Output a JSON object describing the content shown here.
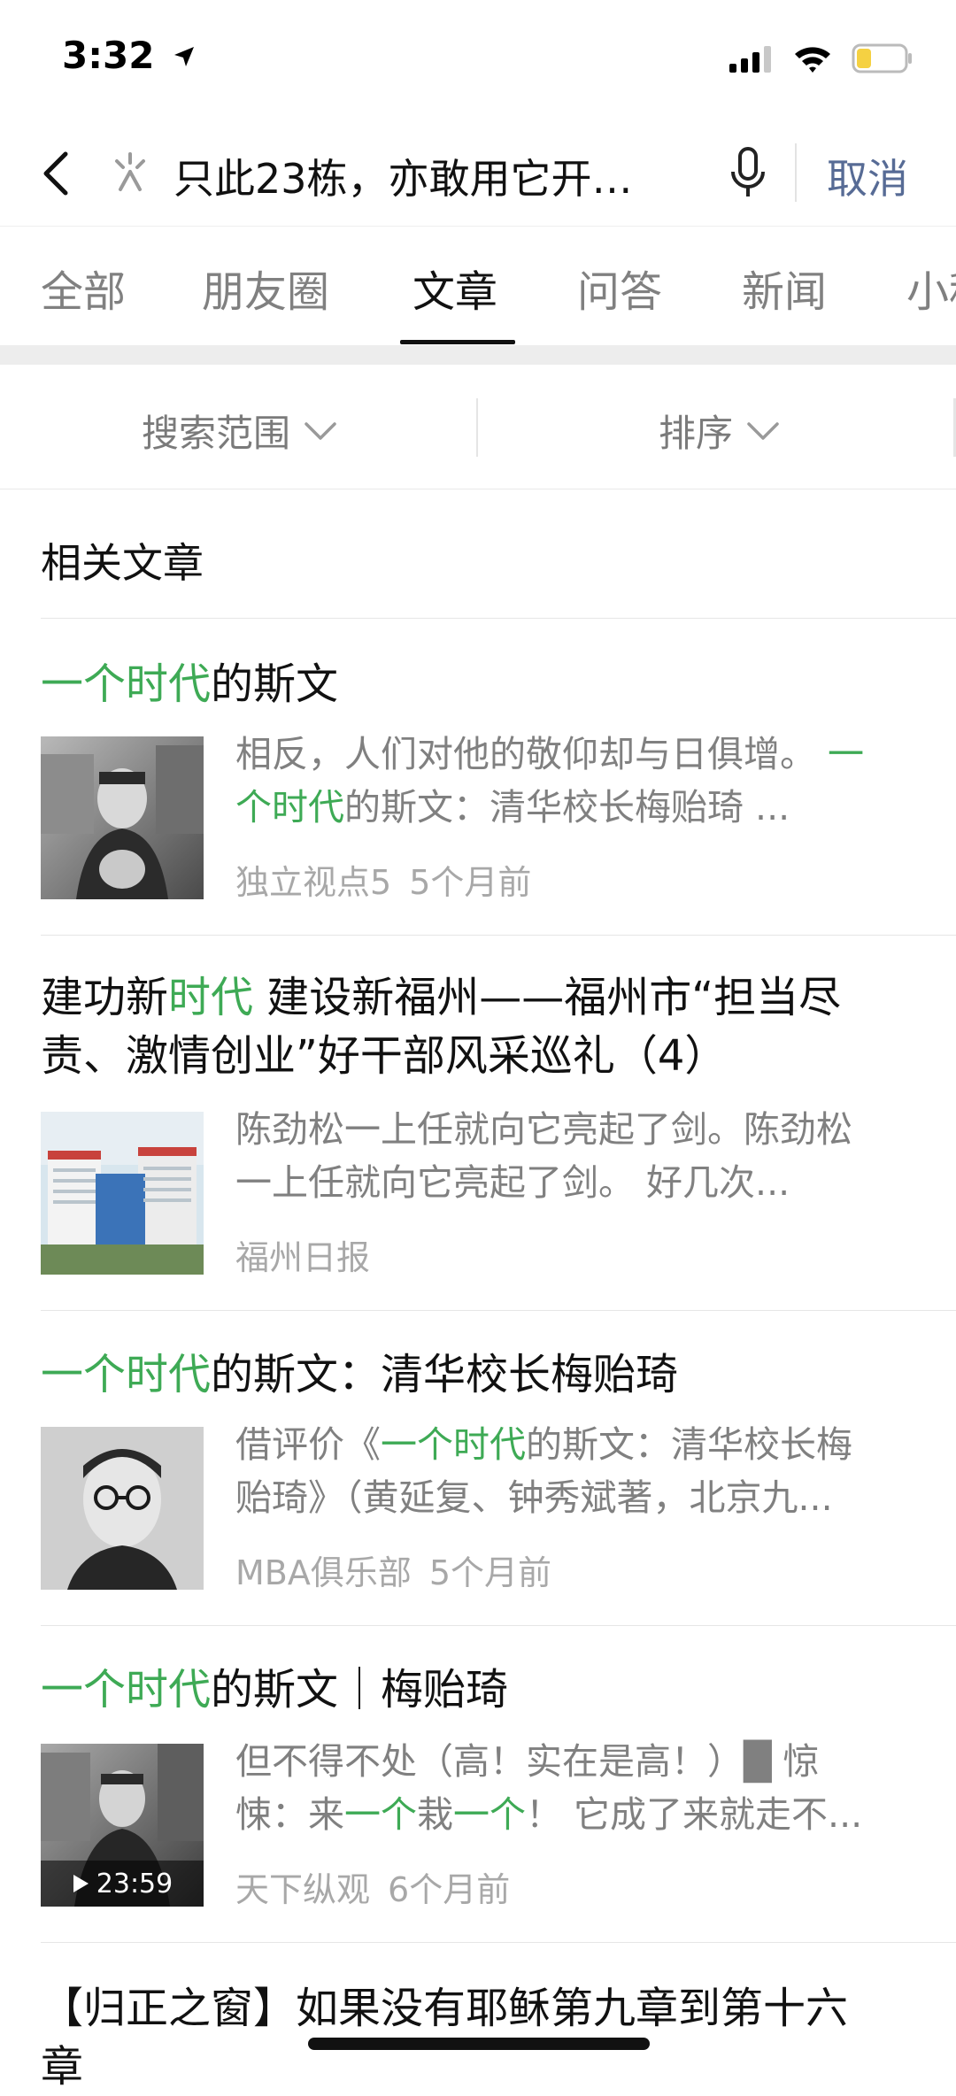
{
  "status_bar": {
    "time": "3:32"
  },
  "search": {
    "query": "只此23栋，亦敢用它开…",
    "cancel_label": "取消"
  },
  "tabs": [
    {
      "label": "全部"
    },
    {
      "label": "朋友圈"
    },
    {
      "label": "文章",
      "active": true
    },
    {
      "label": "问答"
    },
    {
      "label": "新闻"
    },
    {
      "label": "小程"
    }
  ],
  "filters": {
    "scope_label": "搜索范围",
    "sort_label": "排序"
  },
  "section_title": "相关文章",
  "articles": [
    {
      "title_hl": "一个时代",
      "title_rest": "的斯文",
      "snippet_line1_pre": "相反，人们对他的敬仰却与日俱增。",
      "snippet_line1_hl": "一",
      "snippet_line2_hl": "个时代",
      "snippet_line2_rest": "的斯文：清华校长梅贻琦 ...",
      "source": "独立视点5",
      "time": "5个月前"
    },
    {
      "title_line1_pre": "建功新",
      "title_line1_hl": "时代",
      "title_line1_rest": " 建设新福州——福州市“担当尽",
      "title_line2": "责、激情创业”好干部风采巡礼（4）",
      "snippet_line1": "陈劲松一上任就向它亮起了剑。陈劲松",
      "snippet_line2": "一上任就向它亮起了剑。 好几次...",
      "source": "福州日报"
    },
    {
      "title_hl": "一个时代",
      "title_rest": "的斯文：清华校长梅贻琦",
      "snippet_line1_pre": "借评价《",
      "snippet_line1_hl": "一个时代",
      "snippet_line1_rest": "的斯文：清华校长梅",
      "snippet_line2": "贻琦》（黄延复、钟秀斌著，北京九...",
      "source": "MBA俱乐部",
      "time": "5个月前"
    },
    {
      "title_hl": "一个时代",
      "title_rest": "的斯文｜梅贻琦",
      "snippet_line1": "但不得不处（高！实在是高！）█ 惊",
      "snippet_line2_pre": "悚：来",
      "snippet_line2_hl1": "一个",
      "snippet_line2_mid": "栽",
      "snippet_line2_hl2": "一个",
      "snippet_line2_rest": "！ 它成了来就走不...",
      "source": "天下纵观",
      "time": "6个月前",
      "duration": "23:59"
    },
    {
      "title_line1": "【归正之窗】如果没有耶稣第九章到第十六",
      "title_line2": "章"
    }
  ],
  "colors": {
    "highlight": "#3eaa55",
    "link": "#576b95"
  }
}
